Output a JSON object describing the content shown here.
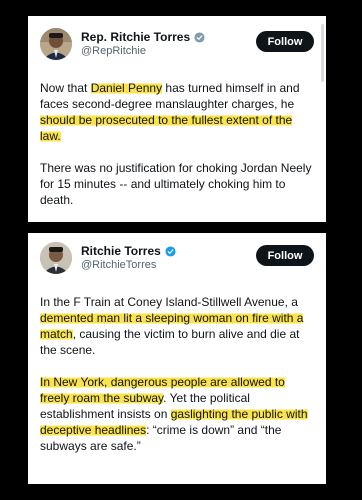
{
  "tweet1": {
    "display_name": "Rep. Ritchie Torres",
    "handle": "@RepRitchie",
    "follow_label": "Follow",
    "badge_color": "#829aab",
    "p1_a": "Now that ",
    "p1_b": "Daniel Penny",
    "p1_c": " has turned himself in and faces second-degree manslaughter charges, he ",
    "p1_d": "should be prosecuted to the fullest extent of the law.",
    "p2": "There was no justification for choking Jordan Neely for 15 minutes -- and ultimately choking him to death."
  },
  "tweet2": {
    "display_name": "Ritchie Torres",
    "handle": "@RitchieTorres",
    "follow_label": "Follow",
    "badge_color": "#1d9bf0",
    "p1_a": "In the F Train at Coney Island-Stillwell Avenue, a ",
    "p1_b": "demented man lit a sleeping woman on fire with a match",
    "p1_c": ", causing the victim to burn alive and die at the scene.",
    "p2_a": "In New York, dangerous people are allowed to freely roam the subway",
    "p2_b": ".  Yet the political establishment insists on ",
    "p2_c": "gaslighting the public with deceptive headlines",
    "p2_d": ": “crime is down” and “the subways are safe.”"
  },
  "colors": {
    "background": "#000000",
    "highlight": "#fbe44b",
    "verified_blue": "#1d9bf0",
    "verified_gray": "#829aab"
  },
  "icons": [
    "verified-badge-icon",
    "avatar"
  ]
}
